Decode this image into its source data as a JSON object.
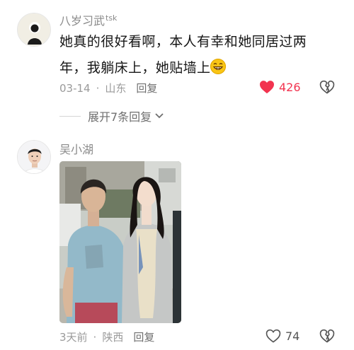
{
  "comments": [
    {
      "username": "八岁习武",
      "username_tag": "tsk",
      "text_line1": "她真的很好看啊，本人有幸和她同居过两",
      "text_line2": "年，我躺床上，她贴墙上",
      "emoji": "grinning-face",
      "date": "03-14",
      "location": "山东",
      "reply_label": "回复",
      "likes": "426",
      "liked": true,
      "expand_label": "展开7条回复"
    },
    {
      "username": "吴小湖",
      "date": "3天前",
      "location": "陕西",
      "reply_label": "回复",
      "likes": "74",
      "liked": false
    }
  ],
  "colors": {
    "like_active": "#f2334f",
    "meta_gray": "#9a9a9a",
    "text": "#161616"
  },
  "separator": "·"
}
